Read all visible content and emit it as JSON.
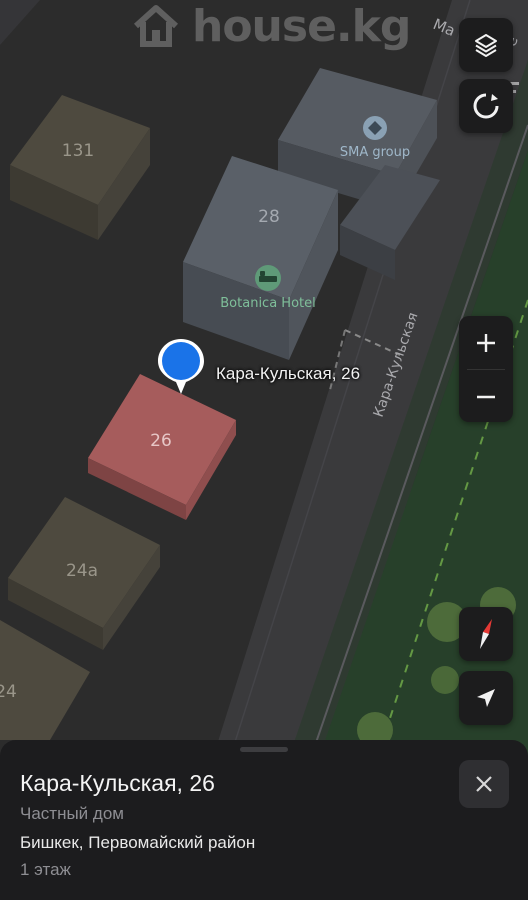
{
  "watermark": {
    "text": "house.kg"
  },
  "map": {
    "street_name": "Кара-Кульская",
    "street_top_right": "Ма",
    "street_top_right_2": "Ге",
    "buildings": {
      "b131": "131",
      "b28": "28",
      "b26": "26",
      "b24a": "24а",
      "b24": "24"
    },
    "pois": {
      "sma": "SMA group",
      "hotel": "Botanica Hotel"
    },
    "selected_pin_label": "Кара-Кульская, 26",
    "colors": {
      "selected_building": "#a65c5c",
      "pin": "#1a73e8",
      "green_strip": "#2a4a2c"
    }
  },
  "controls": {
    "layers_icon": "layers-icon",
    "guidance_icon": "circle-arrow-icon",
    "zoom_in_icon": "plus-icon",
    "zoom_out_icon": "minus-icon",
    "compass_icon": "compass-icon",
    "locate_icon": "navigation-arrow-icon"
  },
  "sheet": {
    "title": "Кара-Кульская, 26",
    "type": "Частный дом",
    "address": "Бишкек, Первомайский район",
    "floors": "1 этаж",
    "close_icon": "close-icon"
  }
}
